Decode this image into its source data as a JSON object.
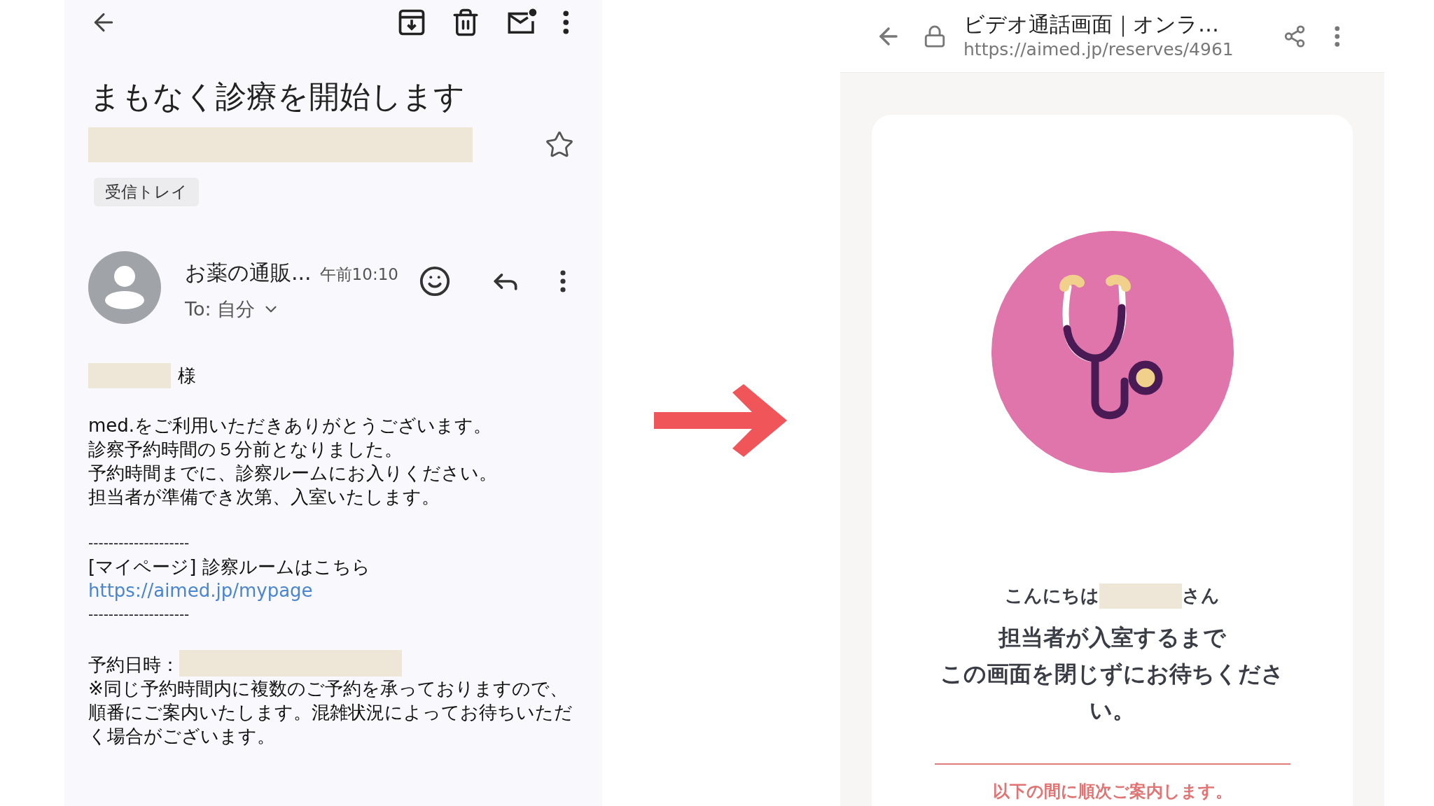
{
  "email": {
    "subject": "まもなく診療を開始します",
    "starred": false,
    "label": "受信トレイ",
    "sender": "お薬の通販...",
    "time": "午前10:10",
    "recipient": "To: 自分",
    "salutation": "様",
    "intro_lines": [
      "med.をご利用いただきありがとうございます。",
      "診察予約時間の５分前となりました。",
      "予約時間までに、診察ルームにお入りください。",
      "担当者が準備でき次第、入室いたします。"
    ],
    "divider_top": "--------------------",
    "mypage_label": "[マイページ] 診察ルームはこちら",
    "mypage_link": "https://aimed.jp/mypage",
    "divider_bottom": "--------------------",
    "date_label": "予約日時：",
    "note": "※同じ予約時間内に複数のご予約を承っておりますので、順番にご案内いたします。混雑状況によってお待ちいただく場合がございます。"
  },
  "browser": {
    "page_title": "ビデオ通話画面｜オンラ…",
    "url": "https://aimed.jp/reserves/4961",
    "greeting_prefix": "こんにちは",
    "greeting_suffix": "さん",
    "message_lines": [
      "担当者が入室するまで",
      "この画面を閉じずにお待ちください。"
    ],
    "notice": "以下の間に順次ご案内します。"
  }
}
